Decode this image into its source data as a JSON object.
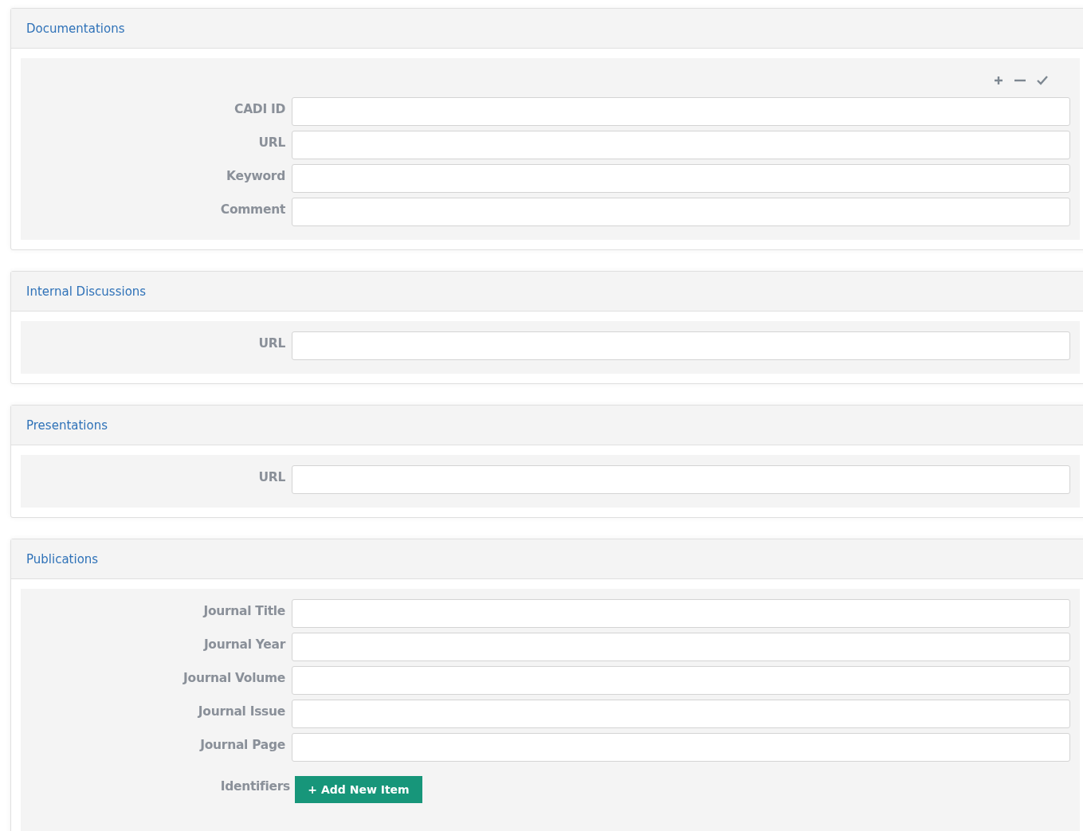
{
  "sections": [
    {
      "title": "Documentations",
      "toolbar": true,
      "fields": [
        {
          "label": "CADI ID",
          "kind": "input"
        },
        {
          "label": "URL",
          "kind": "input"
        },
        {
          "label": "Keyword",
          "kind": "input"
        },
        {
          "label": "Comment",
          "kind": "input"
        }
      ]
    },
    {
      "title": "Internal Discussions",
      "toolbar": false,
      "fields": [
        {
          "label": "URL",
          "kind": "input"
        }
      ]
    },
    {
      "title": "Presentations",
      "toolbar": false,
      "fields": [
        {
          "label": "URL",
          "kind": "input"
        }
      ]
    },
    {
      "title": "Publications",
      "toolbar": false,
      "fields": [
        {
          "label": "Journal Title",
          "kind": "input"
        },
        {
          "label": "Journal Year",
          "kind": "input"
        },
        {
          "label": "Journal Volume",
          "kind": "input"
        },
        {
          "label": "Journal Issue",
          "kind": "input"
        },
        {
          "label": "Journal Page",
          "kind": "input"
        },
        {
          "label": "Identifiers",
          "kind": "button",
          "button": "+ Add New Item"
        }
      ]
    }
  ]
}
